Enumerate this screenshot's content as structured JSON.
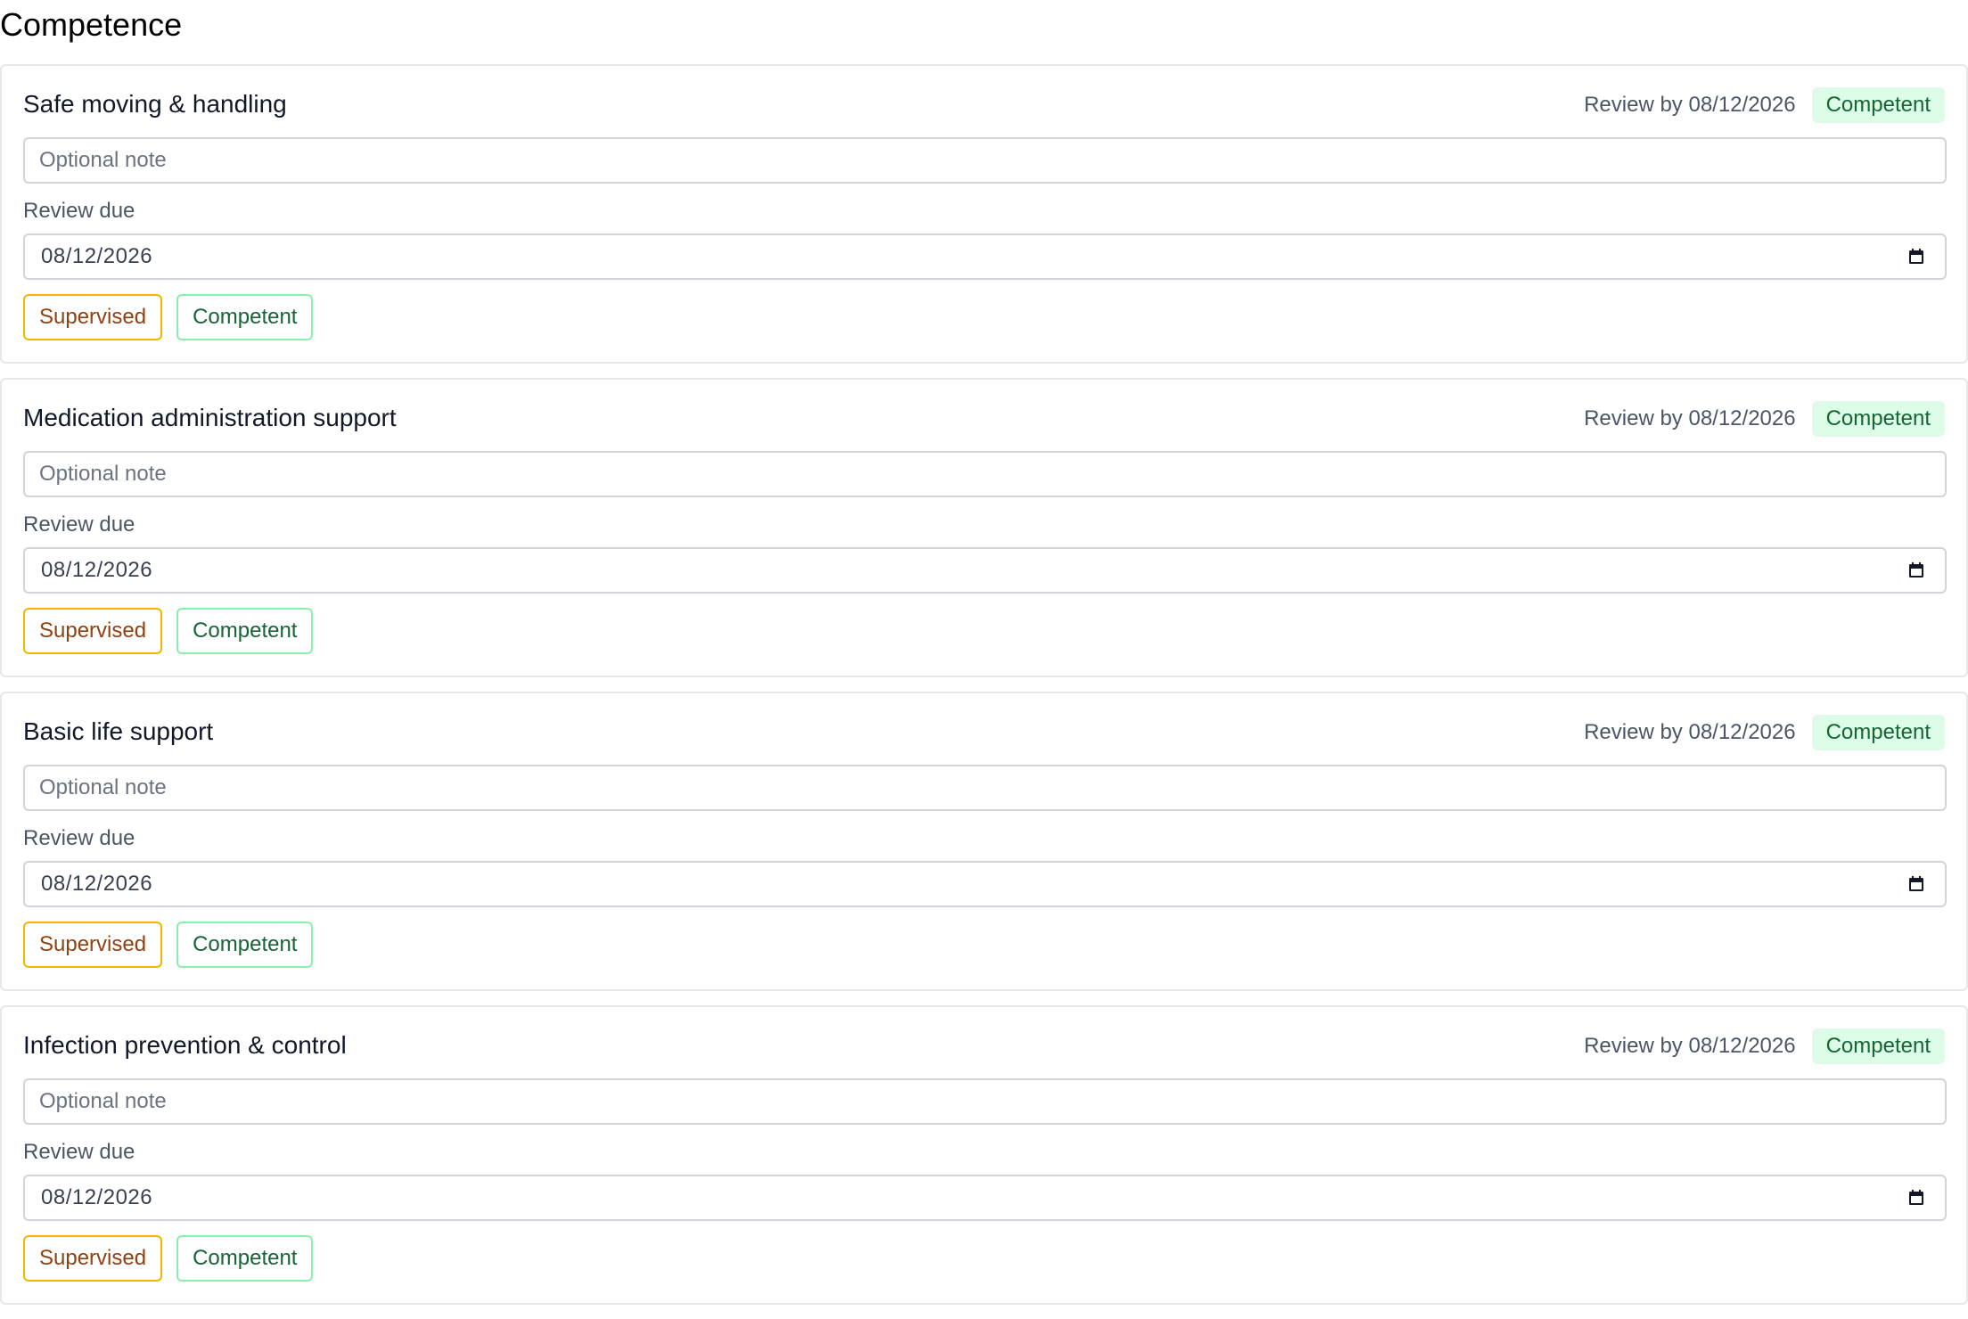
{
  "page": {
    "title": "Competence"
  },
  "labels": {
    "note_placeholder": "Optional note",
    "review_due": "Review due",
    "supervised_button": "Supervised",
    "competent_button": "Competent"
  },
  "colors": {
    "supervised_border": "#f5b400",
    "supervised_text": "#92400e",
    "competent_border": "#86efac",
    "competent_text": "#166534",
    "badge_background": "#dcfce7"
  },
  "icons": {
    "date_picker": "calendar-icon"
  },
  "competencies": [
    {
      "title": "Safe moving & handling",
      "review_by": "Review by 08/12/2026",
      "status": "Competent",
      "note": "",
      "review_due": "08/12/2026"
    },
    {
      "title": "Medication administration support",
      "review_by": "Review by 08/12/2026",
      "status": "Competent",
      "note": "",
      "review_due": "08/12/2026"
    },
    {
      "title": "Basic life support",
      "review_by": "Review by 08/12/2026",
      "status": "Competent",
      "note": "",
      "review_due": "08/12/2026"
    },
    {
      "title": "Infection prevention & control",
      "review_by": "Review by 08/12/2026",
      "status": "Competent",
      "note": "",
      "review_due": "08/12/2026"
    }
  ]
}
